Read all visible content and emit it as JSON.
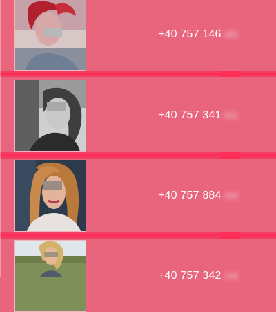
{
  "contacts": [
    {
      "phone": "+40 757 146",
      "hidden": "493"
    },
    {
      "phone": "+40 757 341",
      "hidden": "561"
    },
    {
      "phone": "+40 757 884",
      "hidden": "445"
    },
    {
      "phone": "+40 757 342",
      "hidden": "139"
    }
  ],
  "colors": {
    "background": "#e9657d",
    "divider": "#f13f63",
    "text": "#ffffff"
  }
}
